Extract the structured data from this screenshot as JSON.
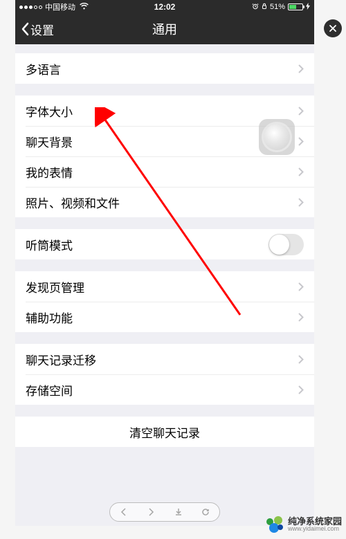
{
  "status": {
    "carrier": "中国移动",
    "time": "12:02",
    "battery_text": "51%"
  },
  "nav": {
    "back_label": "设置",
    "title": "通用"
  },
  "rows": {
    "language": "多语言",
    "font_size": "字体大小",
    "chat_bg": "聊天背景",
    "my_stickers": "我的表情",
    "photos_files": "照片、视频和文件",
    "earpiece": "听筒模式",
    "discover_mgmt": "发现页管理",
    "accessibility": "辅助功能",
    "chat_migrate": "聊天记录迁移",
    "storage": "存储空间",
    "clear_chat": "清空聊天记录"
  },
  "watermark": {
    "cn": "纯净系统家园",
    "url": "www.yidaimei.com"
  }
}
